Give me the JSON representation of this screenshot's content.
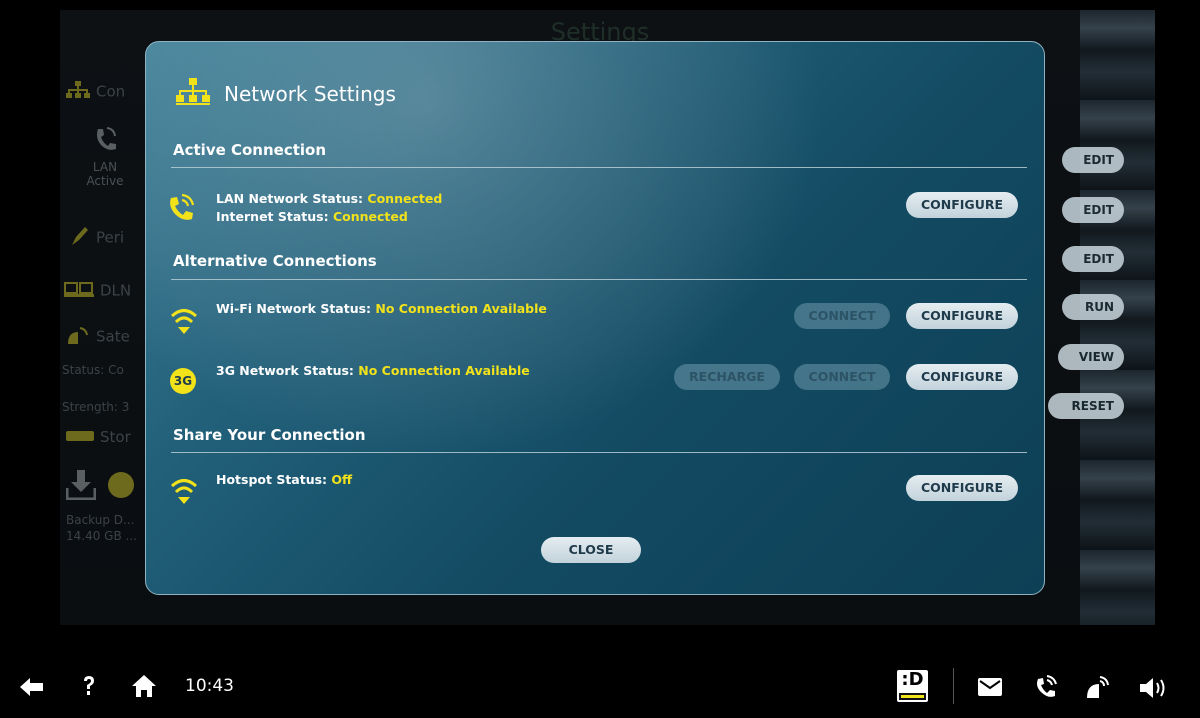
{
  "background": {
    "title": "Settings",
    "sidebar": {
      "connections_label": "Con",
      "lan_label": "LAN",
      "lan_status": "Active",
      "peripherals_label": "Peri",
      "dlna_label": "DLN",
      "satellite_label": "Sate",
      "status_line": "Status: Co",
      "strength_line": "Strength: 3",
      "storage_label": "Stor",
      "backup_line1": "Backup D...",
      "backup_line2": "14.40 GB ..."
    },
    "right_buttons": [
      "EDIT",
      "EDIT",
      "EDIT",
      "RUN",
      "VIEW",
      "RESET"
    ]
  },
  "modal": {
    "title": "Network Settings",
    "sections": {
      "active": "Active Connection",
      "alternative": "Alternative Connections",
      "share": "Share Your Connection"
    },
    "lan": {
      "status_label": "LAN Network Status:",
      "status_value": "Connected",
      "internet_label": "Internet Status:",
      "internet_value": "Connected",
      "configure": "CONFIGURE"
    },
    "wifi": {
      "status_label": "Wi-Fi Network Status:",
      "status_value": "No Connection Available",
      "connect": "CONNECT",
      "configure": "CONFIGURE"
    },
    "threeg": {
      "badge": "3G",
      "status_label": "3G Network Status:",
      "status_value": "No Connection Available",
      "recharge": "RECHARGE",
      "connect": "CONNECT",
      "configure": "CONFIGURE"
    },
    "hotspot": {
      "status_label": "Hotspot Status:",
      "status_value": "Off",
      "configure": "CONFIGURE"
    },
    "close": "CLOSE"
  },
  "bottombar": {
    "clock": "10:43",
    "icons": [
      "back-arrow-icon",
      "help-icon",
      "home-icon",
      "dvd-logo-icon",
      "mail-icon",
      "phone-icon",
      "satellite-icon",
      "volume-icon"
    ]
  },
  "colors": {
    "accent_yellow": "#f2e21a",
    "modal_dark": "#0d3f55",
    "modal_light": "#3f7f97"
  }
}
